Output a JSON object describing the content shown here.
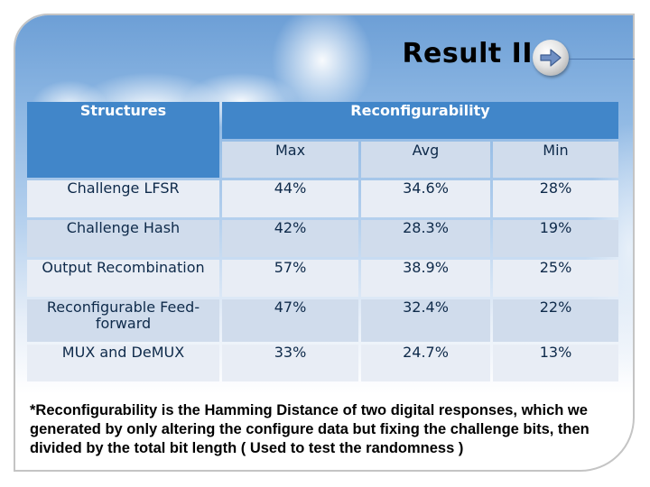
{
  "slide": {
    "title": "Result II",
    "nav_icon": "arrow-right-icon"
  },
  "table": {
    "header": {
      "structures": "Structures",
      "reconfigurability": "Reconfigurability",
      "columns": [
        "Max",
        "Avg",
        "Min"
      ]
    },
    "rows": [
      {
        "structure": "Challenge LFSR",
        "max": "44%",
        "avg": "34.6%",
        "min": "28%"
      },
      {
        "structure": "Challenge Hash",
        "max": "42%",
        "avg": "28.3%",
        "min": "19%"
      },
      {
        "structure": "Output Recombination",
        "max": "57%",
        "avg": "38.9%",
        "min": "25%"
      },
      {
        "structure": "Reconfigurable Feed-forward",
        "max": "47%",
        "avg": "32.4%",
        "min": "22%"
      },
      {
        "structure": "MUX and DeMUX",
        "max": "33%",
        "avg": "24.7%",
        "min": "13%"
      }
    ]
  },
  "footnote": "*Reconfigurability is the Hamming Distance of two digital responses, which we generated by only altering the configure data but fixing the challenge bits, then divided by the total bit length ( Used to test the randomness )",
  "colors": {
    "header_blue": "#4186c9",
    "row_light": "#e8edf5",
    "row_dark": "#d0dcec",
    "text_navy": "#0e2a4a"
  }
}
